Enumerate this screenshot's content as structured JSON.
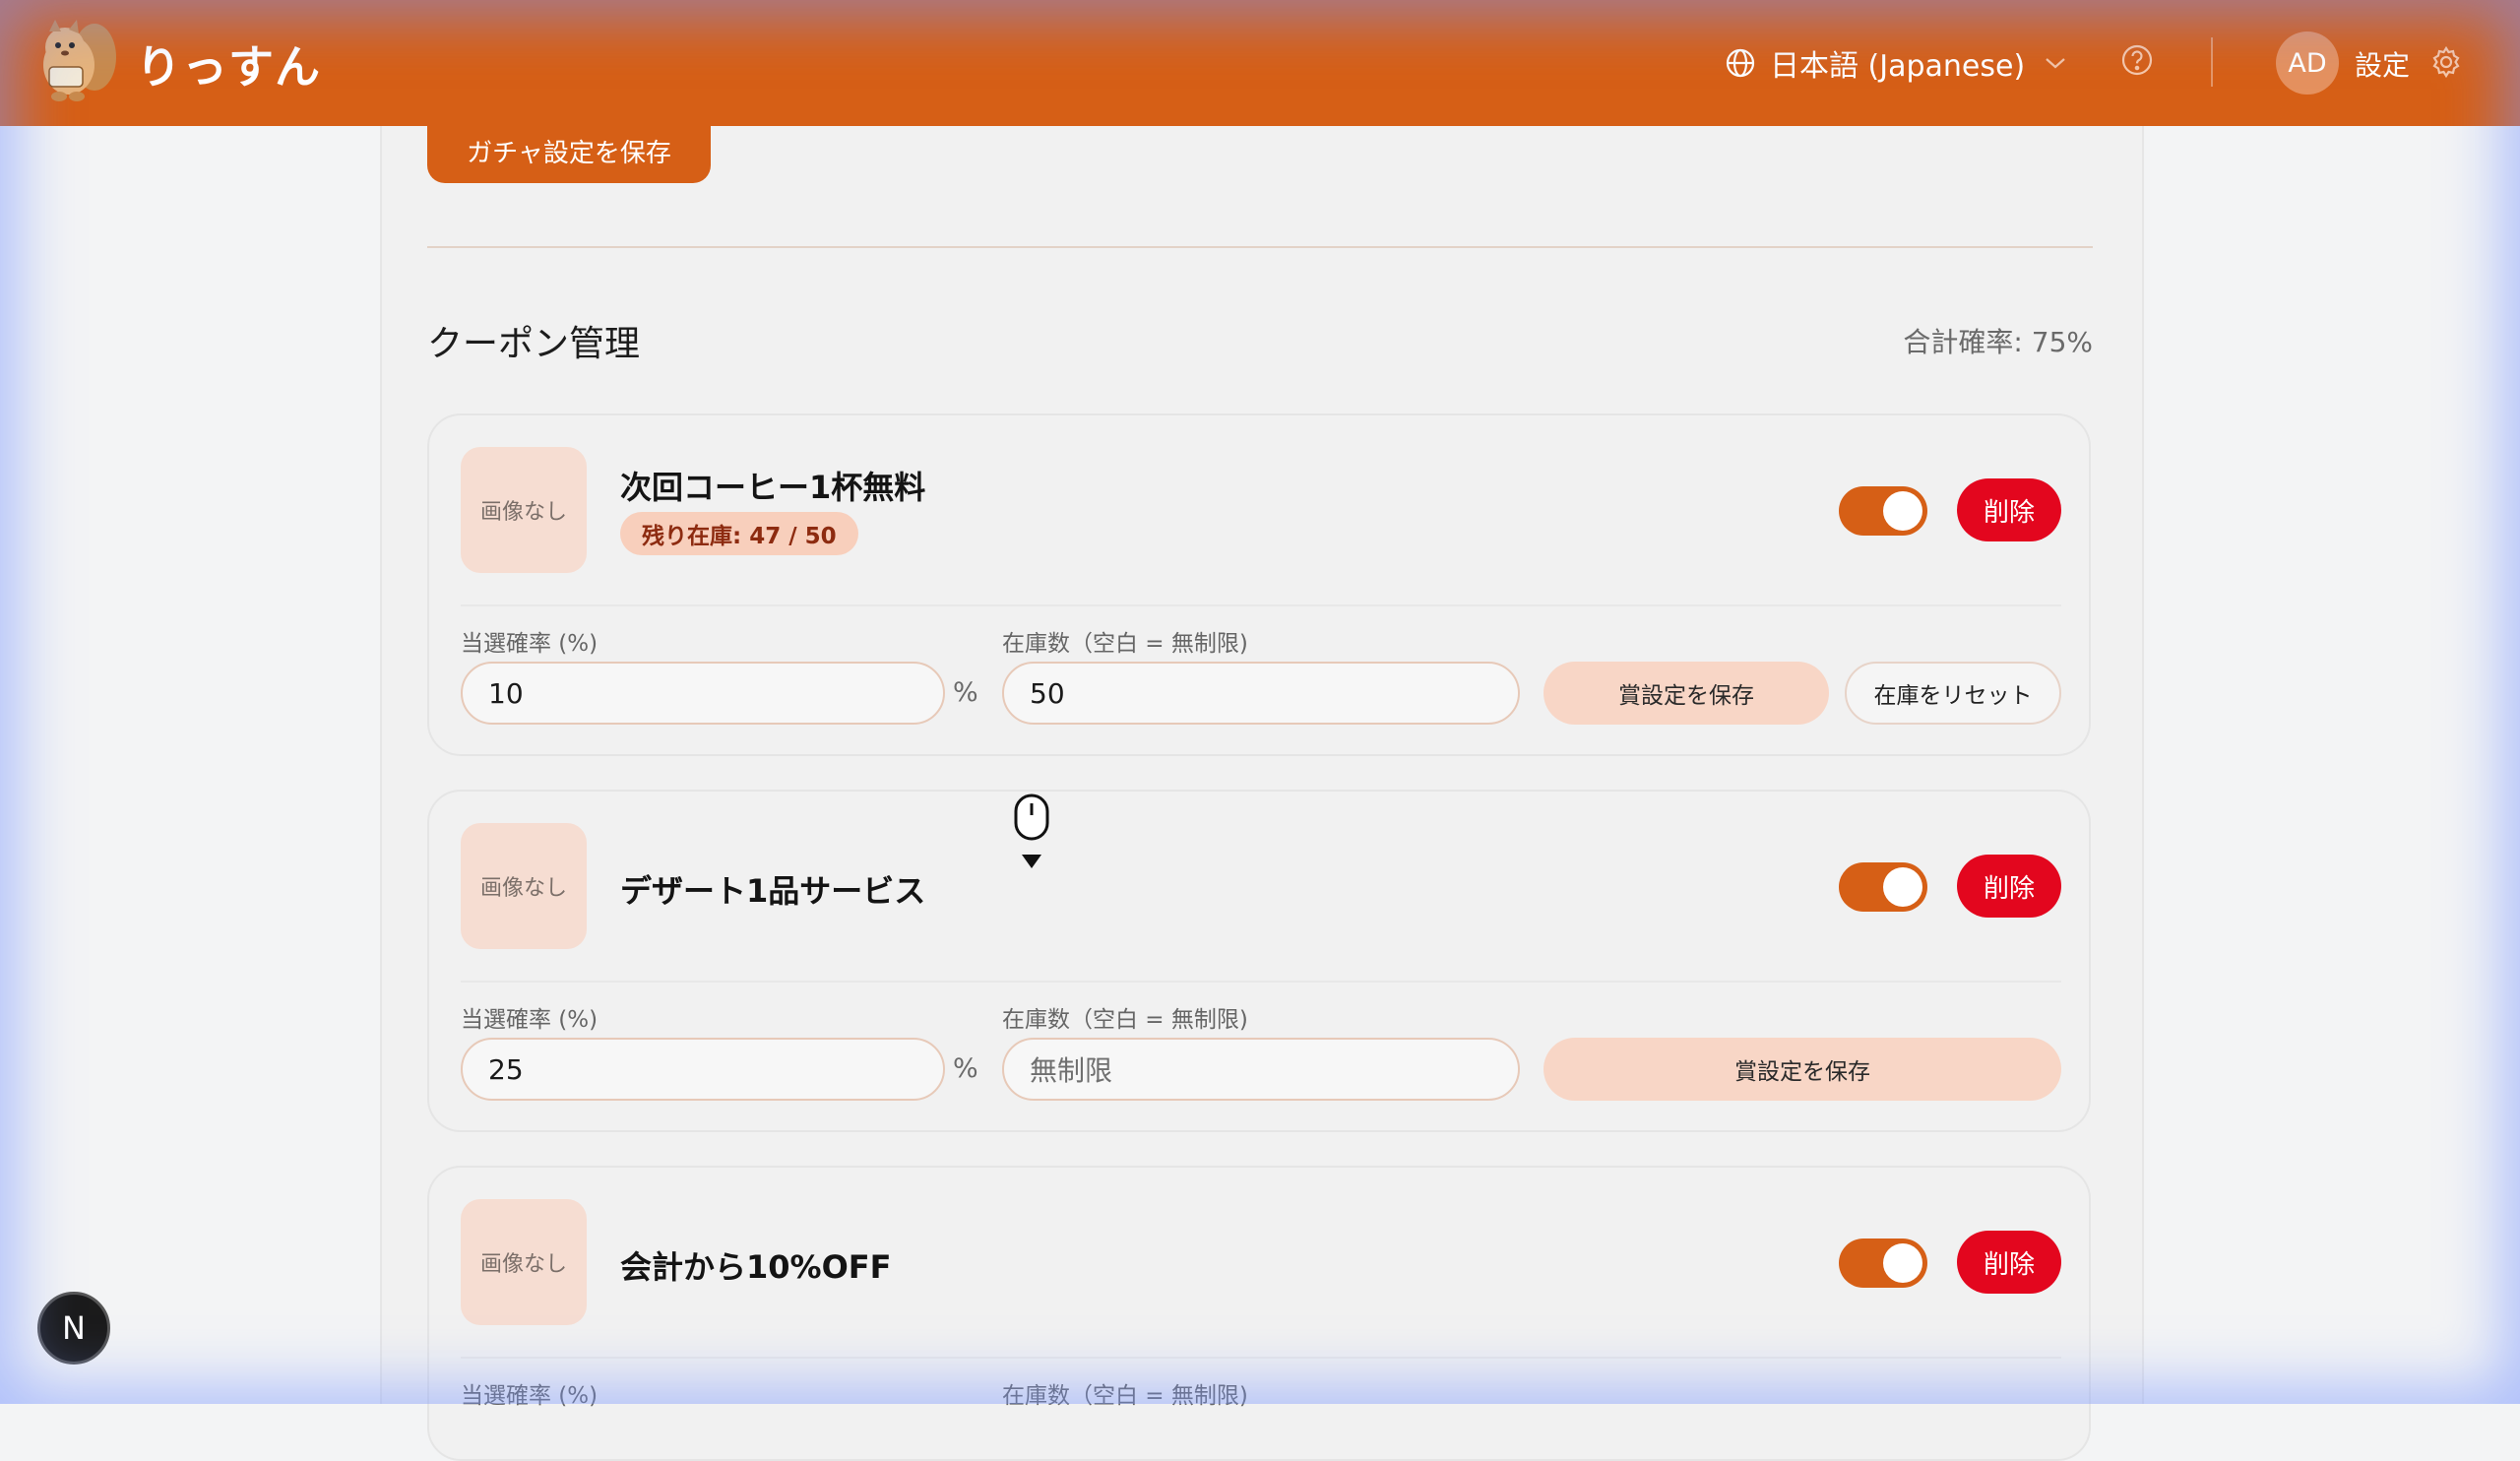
{
  "header": {
    "brand": "りっすん",
    "language": "日本語 (Japanese)",
    "avatar_initials": "AD",
    "settings_label": "設定"
  },
  "gacha": {
    "save_label": "ガチャ設定を保存"
  },
  "coupons": {
    "title": "クーポン管理",
    "total_probability": "合計確率: 75%",
    "items": [
      {
        "image_placeholder": "画像なし",
        "name": "次回コーヒー1杯無料",
        "stock_badge": "残り在庫: 47 / 50",
        "enabled": true,
        "delete_label": "削除",
        "prob_label": "当選確率 (%)",
        "prob_value": "10",
        "percent_sign": "%",
        "stock_label": "在庫数（空白 = 無制限)",
        "stock_value": "50",
        "save_label": "賞設定を保存",
        "reset_label": "在庫をリセット"
      },
      {
        "image_placeholder": "画像なし",
        "name": "デザート1品サービス",
        "enabled": true,
        "delete_label": "削除",
        "prob_label": "当選確率 (%)",
        "prob_value": "25",
        "percent_sign": "%",
        "stock_label": "在庫数（空白 = 無制限)",
        "stock_placeholder": "無制限",
        "save_label": "賞設定を保存"
      },
      {
        "image_placeholder": "画像なし",
        "name": "会計から10%OFF",
        "enabled": true,
        "delete_label": "削除",
        "prob_label": "当選確率 (%)",
        "stock_label": "在庫数（空白 = 無制限)"
      }
    ]
  },
  "dev_badge": "N",
  "colors": {
    "brand": "#d65f16",
    "danger": "#e3061e",
    "soft": "#f8d6c6"
  }
}
